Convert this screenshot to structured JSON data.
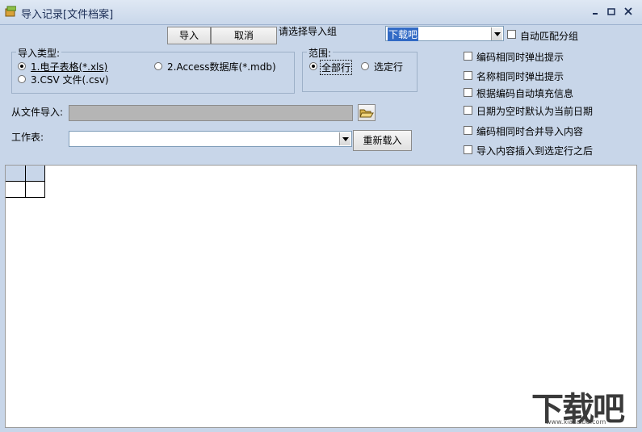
{
  "window": {
    "title": "导入记录[文件档案]"
  },
  "toolbar": {
    "import_label": "导入",
    "cancel_label": "取消"
  },
  "group_select": {
    "label": "请选择导入组",
    "value": "下载吧",
    "auto_match_label": "自动匹配分组"
  },
  "import_type": {
    "legend": "导入类型:",
    "options": [
      {
        "label": "1.电子表格(*.xls)",
        "selected": true
      },
      {
        "label": "2.Access数据库(*.mdb)",
        "selected": false
      },
      {
        "label": "3.CSV 文件(.csv)",
        "selected": false
      }
    ]
  },
  "range": {
    "legend": "范围:",
    "options": [
      {
        "label": "全部行",
        "selected": true
      },
      {
        "label": "选定行",
        "selected": false
      }
    ]
  },
  "options": [
    {
      "label": "编码相同时弹出提示",
      "checked": false
    },
    {
      "label": "名称相同时弹出提示",
      "checked": false
    },
    {
      "label": "根据编码自动填充信息",
      "checked": false
    },
    {
      "label": "日期为空时默认为当前日期",
      "checked": false
    },
    {
      "label": "编码相同时合并导入内容",
      "checked": false
    },
    {
      "label": "导入内容插入到选定行之后",
      "checked": false
    }
  ],
  "file": {
    "label": "从文件导入:",
    "value": ""
  },
  "worksheet": {
    "label": "工作表:",
    "value": "",
    "reload_label": "重新载入"
  },
  "watermark": {
    "text": "下载吧",
    "sub": "www.xiazaiba.com"
  }
}
